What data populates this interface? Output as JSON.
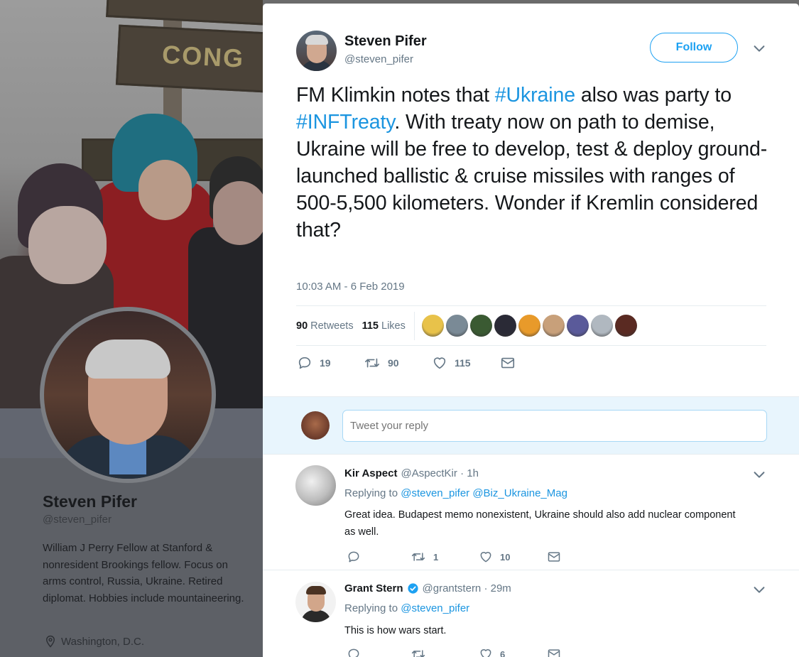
{
  "background_profile": {
    "name": "Steven Pifer",
    "handle": "@steven_pifer",
    "bio": "William J Perry Fellow at Stanford & nonresident Brookings fellow. Focus on arms control, Russia, Ukraine. Retired diplomat. Hobbies include mountaineering.",
    "location": "Washington, D.C.",
    "sign_text": "CONG"
  },
  "tweet": {
    "author_name": "Steven Pifer",
    "author_handle": "@steven_pifer",
    "follow_label": "Follow",
    "text_parts": {
      "p1": "FM Klimkin notes that ",
      "tag1": "#Ukraine",
      "p2": " also was party to ",
      "tag2": "#INFTreaty",
      "p3": ". With treaty now on path to demise, Ukraine will be free to develop, test & deploy ground-launched ballistic & cruise missiles with ranges of 500-5,500 kilometers. Wonder if Kremlin considered that?"
    },
    "timestamp": "10:03 AM - 6 Feb 2019",
    "retweets_count": "90",
    "retweets_label": "Retweets",
    "likes_count": "115",
    "likes_label": "Likes",
    "liker_avatar_colors": [
      "#e8c24a",
      "#7a8a96",
      "#3a5a32",
      "#2a2a36",
      "#e89a2a",
      "#c8a07a",
      "#5a5a9a",
      "#b0b8c0",
      "#5a2a22"
    ],
    "actions": {
      "replies": "19",
      "retweets": "90",
      "likes": "115"
    }
  },
  "reply_box": {
    "placeholder": "Tweet your reply"
  },
  "replies": [
    {
      "name": "Kir Aspect",
      "handle": "@AspectKir",
      "time": "· 1h",
      "replying_label": "Replying to",
      "replying_to": "@steven_pifer @Biz_Ukraine_Mag",
      "text": "Great idea. Budapest memo nonexistent, Ukraine should also add nuclear component as well.",
      "reply_count": "",
      "retweet_count": "1",
      "like_count": "10"
    },
    {
      "name": "Grant Stern",
      "handle": "@grantstern",
      "time": "· 29m",
      "replying_label": "Replying to",
      "replying_to": "@steven_pifer",
      "text": "This is how wars start.",
      "reply_count": "",
      "retweet_count": "",
      "like_count": "6"
    }
  ],
  "colors": {
    "accent": "#1da1f2",
    "link": "#1b95e0",
    "muted": "#657786"
  }
}
